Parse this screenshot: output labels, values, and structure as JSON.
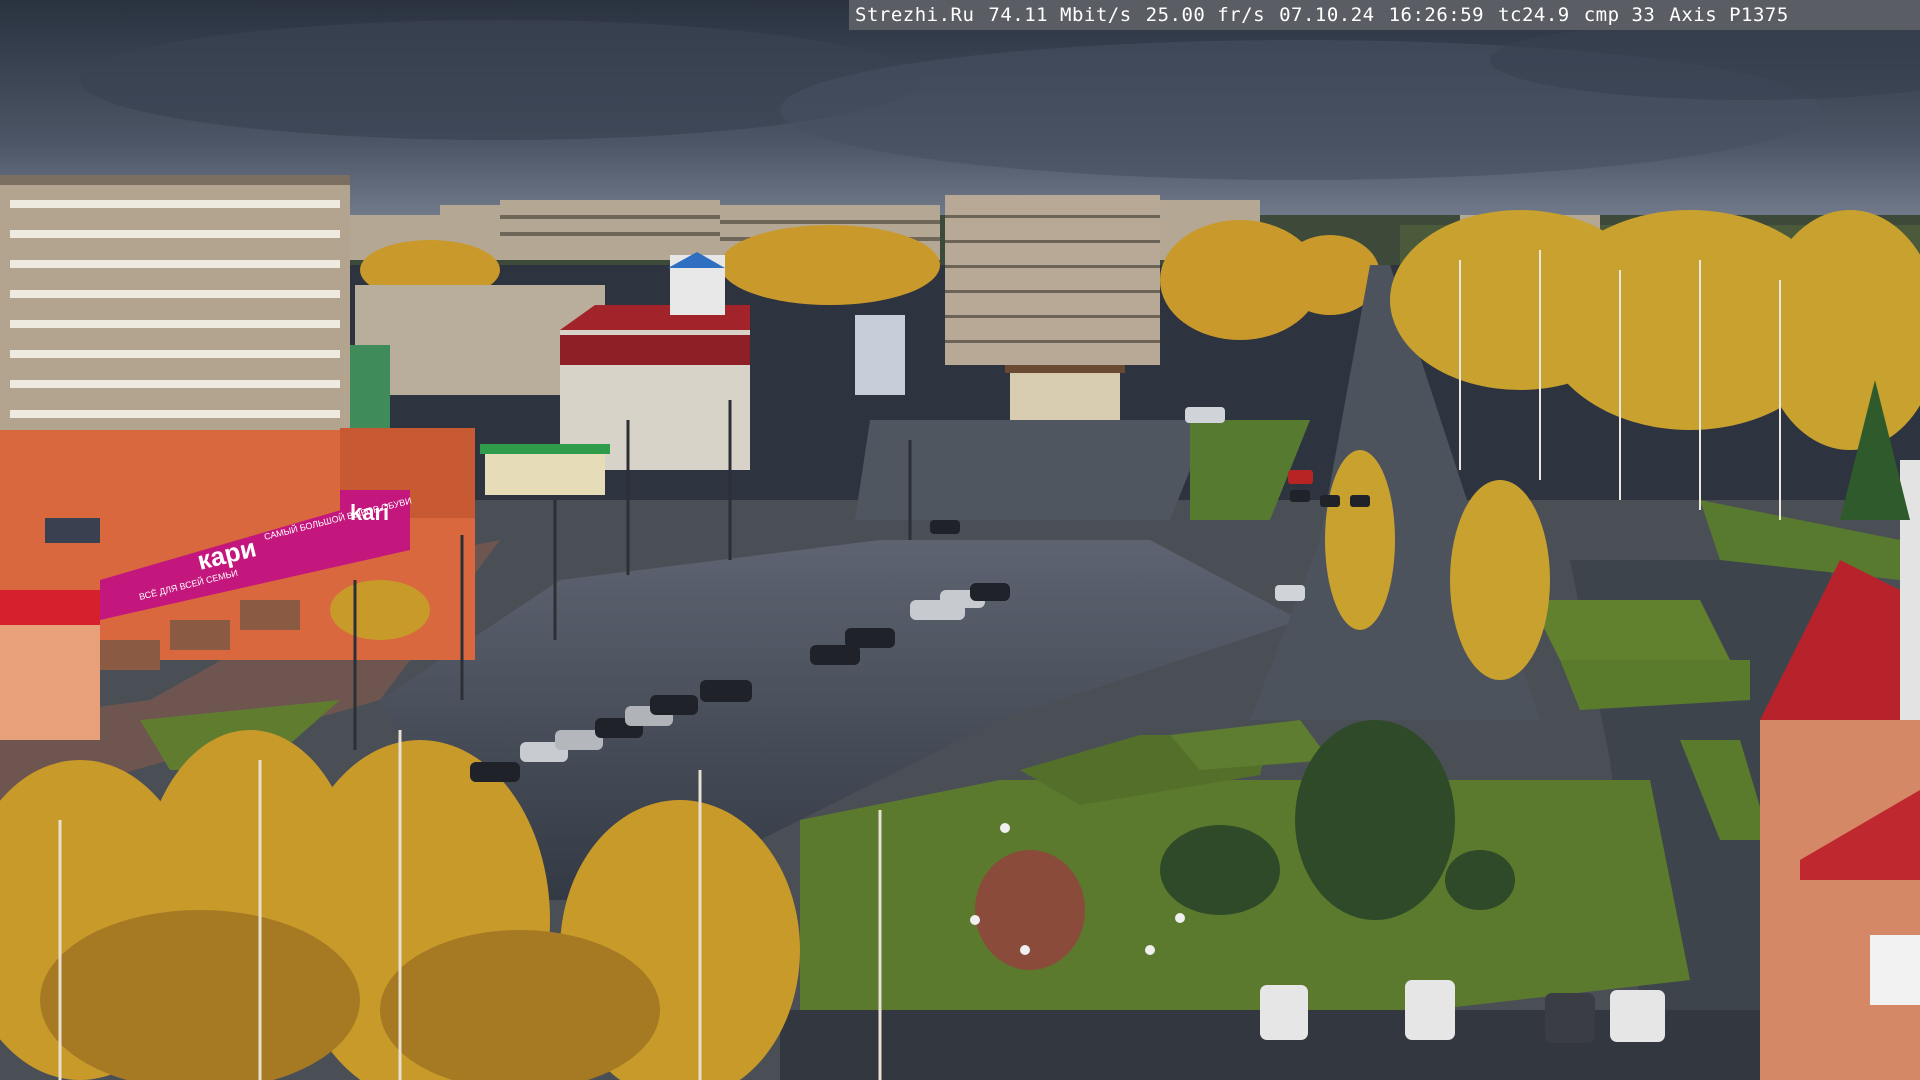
{
  "overlay": {
    "site": "Strezhi.Ru",
    "bitrate": "74.11 Mbit/s",
    "framerate": "25.00 fr/s",
    "date": "07.10.24",
    "time": "16:26:59",
    "tc": "tc24.9",
    "cmp": "cmp 33",
    "camera": "Axis P1375"
  },
  "store": {
    "brand": "kari",
    "banner_left": "кари",
    "banner_left_tag": "ВСЁ ДЛЯ ВСЕЙ СЕМЬИ",
    "banner_right_tag": "САМЫЙ БОЛЬШОЙ ВЫБОР ОБУВИ"
  },
  "colors": {
    "sky_top": "#2e3644",
    "sky_bottom": "#7a8494",
    "kari_magenta": "#c4177e",
    "mall_orange": "#d9683e",
    "asphalt": "#3b4048",
    "grass": "#5c7a2e",
    "birch_yellow": "#c89a2a",
    "roof_red": "#b8232b"
  }
}
